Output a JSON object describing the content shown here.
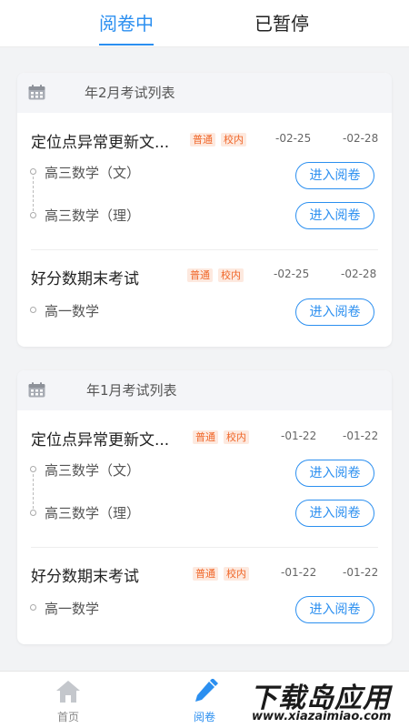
{
  "tabs": {
    "reviewing": "阅卷中",
    "paused": "已暂停"
  },
  "months": [
    {
      "title": "年2月考试列表",
      "exams": [
        {
          "name": "定位点异常更新文...",
          "tags": [
            "普通",
            "校内"
          ],
          "start": "-02-25",
          "end": "-02-28",
          "subjects": [
            "高三数学（文）",
            "高三数学（理）"
          ]
        },
        {
          "name": "好分数期末考试",
          "tags": [
            "普通",
            "校内"
          ],
          "start": "-02-25",
          "end": "-02-28",
          "subjects": [
            "高一数学"
          ]
        }
      ]
    },
    {
      "title": "年1月考试列表",
      "exams": [
        {
          "name": "定位点异常更新文...",
          "tags": [
            "普通",
            "校内"
          ],
          "start": "-01-22",
          "end": "-01-22",
          "subjects": [
            "高三数学（文）",
            "高三数学（理）"
          ]
        },
        {
          "name": "好分数期末考试",
          "tags": [
            "普通",
            "校内"
          ],
          "start": "-01-22",
          "end": "-01-22",
          "subjects": [
            "高一数学"
          ]
        }
      ]
    }
  ],
  "enter_label": "进入阅卷",
  "bottom_nav": {
    "home": "首页",
    "review": "阅卷"
  },
  "watermark": {
    "main": "下载岛应用",
    "url": "www.xiazaimiao.com"
  },
  "colors": {
    "accent": "#2b8ff0",
    "tag_text": "#f0672a",
    "tag_bg": "#fde9df"
  },
  "icons": {
    "calendar": "calendar-icon",
    "home": "home-icon",
    "review": "pen-icon"
  }
}
